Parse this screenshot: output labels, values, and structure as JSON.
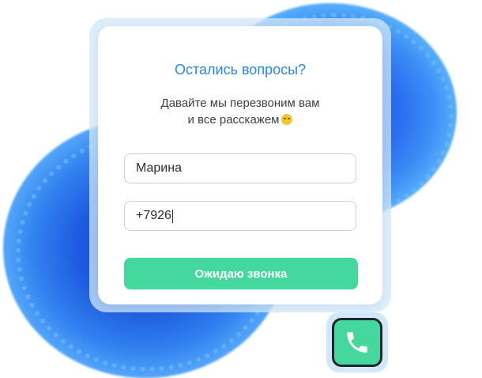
{
  "form": {
    "title": "Остались вопросы?",
    "subtitle_line1": "Давайте мы перезвоним вам",
    "subtitle_line2": "и все расскажем",
    "emoji_icon": "winking-face-icon",
    "name_value": "Марина",
    "phone_value": "+7926",
    "submit_label": "Ожидаю звонка"
  },
  "call_button": {
    "icon": "phone-icon"
  },
  "colors": {
    "accent_title": "#2a86e8",
    "button_green": "#45d89c",
    "blob_blue": "#2a6cf0"
  }
}
